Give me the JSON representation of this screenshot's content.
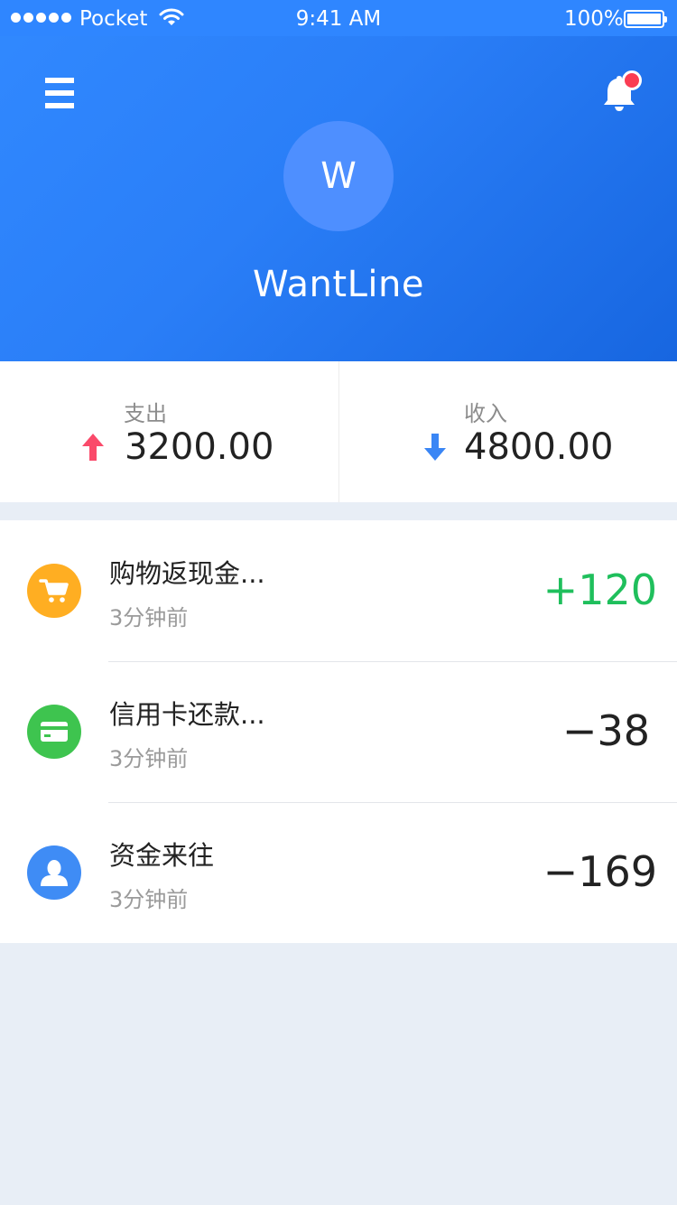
{
  "status_bar": {
    "carrier": "Pocket",
    "time": "9:41 AM",
    "battery": "100%"
  },
  "header": {
    "avatar_initial": "W",
    "username": "WantLine",
    "notification_badge": true
  },
  "summary": {
    "expense_label": "支出",
    "expense_value": "3200.00",
    "income_label": "收入",
    "income_value": "4800.00"
  },
  "transactions": [
    {
      "title": "购物返现金...",
      "time": "3分钟前",
      "amount": "+120",
      "icon": "cart-icon",
      "icon_color": "#ffae22",
      "positive": true
    },
    {
      "title": "信用卡还款...",
      "time": "3分钟前",
      "amount": "−38",
      "icon": "credit-card-icon",
      "icon_color": "#3ec44f",
      "positive": false
    },
    {
      "title": "资金来往",
      "time": "3分钟前",
      "amount": "−169",
      "icon": "user-icon",
      "icon_color": "#3f8cf5",
      "positive": false
    }
  ],
  "colors": {
    "brand_blue": "#2a7ef7",
    "income_green": "#1fbf5c",
    "expense_red": "#fa4a6a",
    "badge_red": "#fa3d53"
  }
}
